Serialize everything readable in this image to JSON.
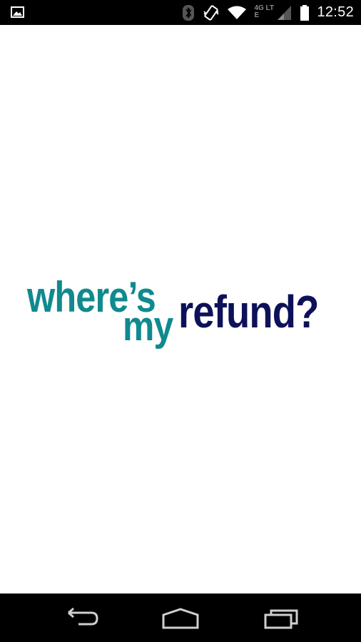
{
  "status_bar": {
    "time": "12:52",
    "network_label": "4G LTE",
    "icons": [
      "image-notification-icon",
      "bluetooth-icon",
      "vibrate-icon",
      "wifi-icon",
      "cellular-signal-icon",
      "battery-icon"
    ]
  },
  "logo": {
    "line1": "where’s",
    "line2": "my",
    "line3": "refund?",
    "teal_color": "#0f8a8e",
    "navy_color": "#0d1159"
  },
  "nav_bar": {
    "icons": [
      "back-icon",
      "home-icon",
      "recent-apps-icon"
    ]
  }
}
